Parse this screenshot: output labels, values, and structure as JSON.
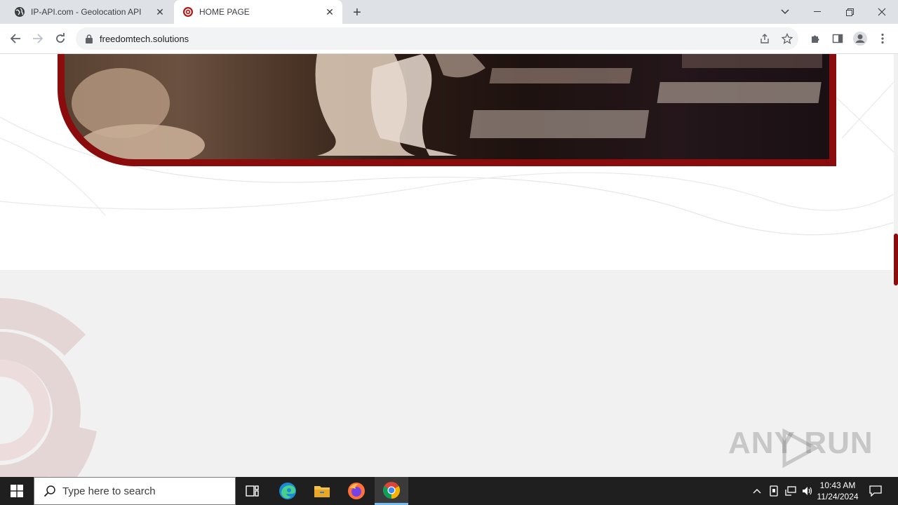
{
  "browser": {
    "tabs": [
      {
        "title": "IP-API.com - Geolocation API",
        "favicon": "globe-icon",
        "active": false
      },
      {
        "title": "HOME PAGE",
        "favicon": "site-logo-icon",
        "active": true
      }
    ],
    "url": "freedomtech.solutions"
  },
  "watermark": {
    "text": "ANY  RUN"
  },
  "taskbar": {
    "search_placeholder": "Type here to search",
    "time": "10:43 AM",
    "date": "11/24/2024"
  },
  "colors": {
    "brand_red": "#8b0c0c",
    "section_gray": "#f1f1f1",
    "taskbar": "#1f1f1f",
    "tab_strip": "#dee1e6"
  }
}
